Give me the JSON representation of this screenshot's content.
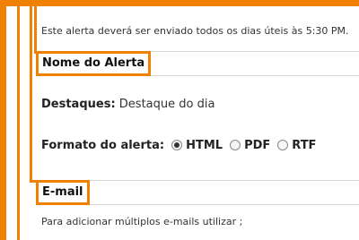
{
  "info_text": "Este alerta deverá ser enviado todos os dias úteis às 5:30 PM.",
  "sections": {
    "name_label": "Nome do Alerta",
    "email_label": "E-mail"
  },
  "highlights": {
    "label": "Destaques:",
    "value": "Destaque do dia"
  },
  "format": {
    "label": "Formato do alerta:",
    "options": [
      "HTML",
      "PDF",
      "RTF"
    ],
    "selected": "HTML"
  },
  "email_hint": "Para adicionar múltiplos e-mails utilizar ;",
  "colors": {
    "accent": "#f08000",
    "border": "#d7d7d7"
  }
}
